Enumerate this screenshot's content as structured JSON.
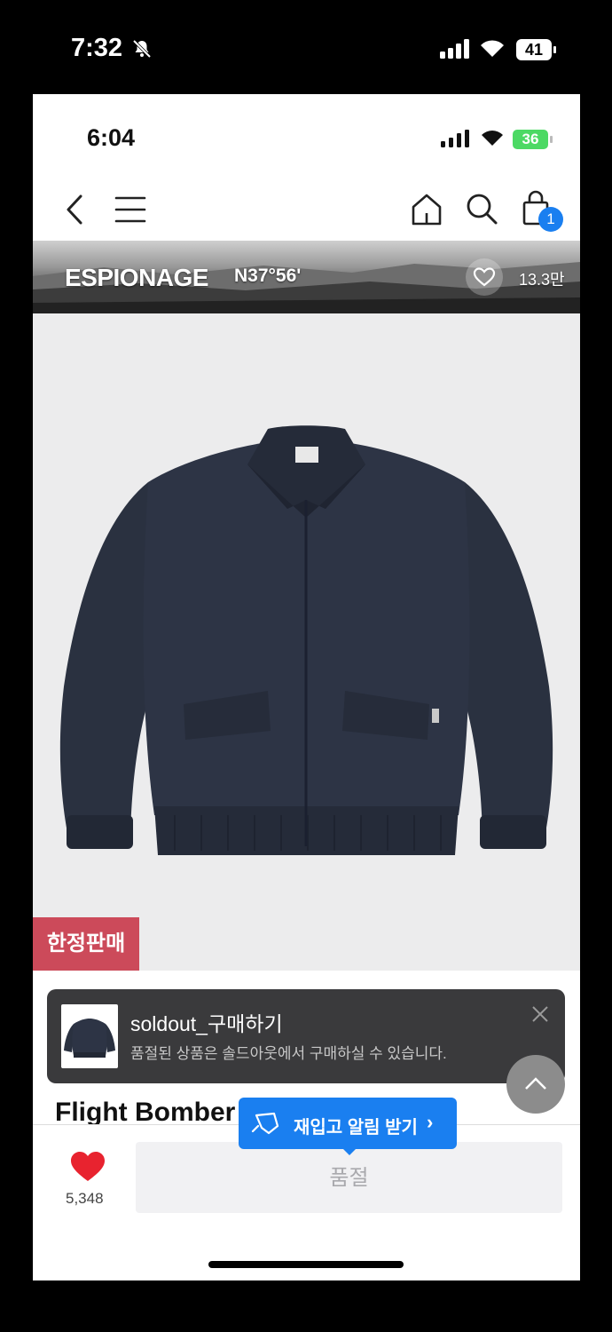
{
  "outer_status": {
    "time": "7:32",
    "battery": "41"
  },
  "inner_status": {
    "time": "6:04",
    "battery": "36"
  },
  "nav": {
    "cart_count": "1"
  },
  "brand_banner": {
    "brand": "ESPIONAGE",
    "coordinate": "N37°56'",
    "like_count": "13.3만"
  },
  "product": {
    "badge": "한정판매",
    "title": "Flight Bomber"
  },
  "toast": {
    "title": "soldout_구매하기",
    "subtitle": "품절된 상품은 솔드아웃에서 구매하실 수 있습니다."
  },
  "restock": {
    "label": "재입고 알림 받기",
    "arrow": "›"
  },
  "bottom": {
    "like_count": "5,348",
    "soldout_label": "품절"
  },
  "colors": {
    "accent_blue": "#1a7ff0",
    "badge_red": "#cc4a5a",
    "heart_red": "#e8232f",
    "battery_green": "#4cd964"
  }
}
